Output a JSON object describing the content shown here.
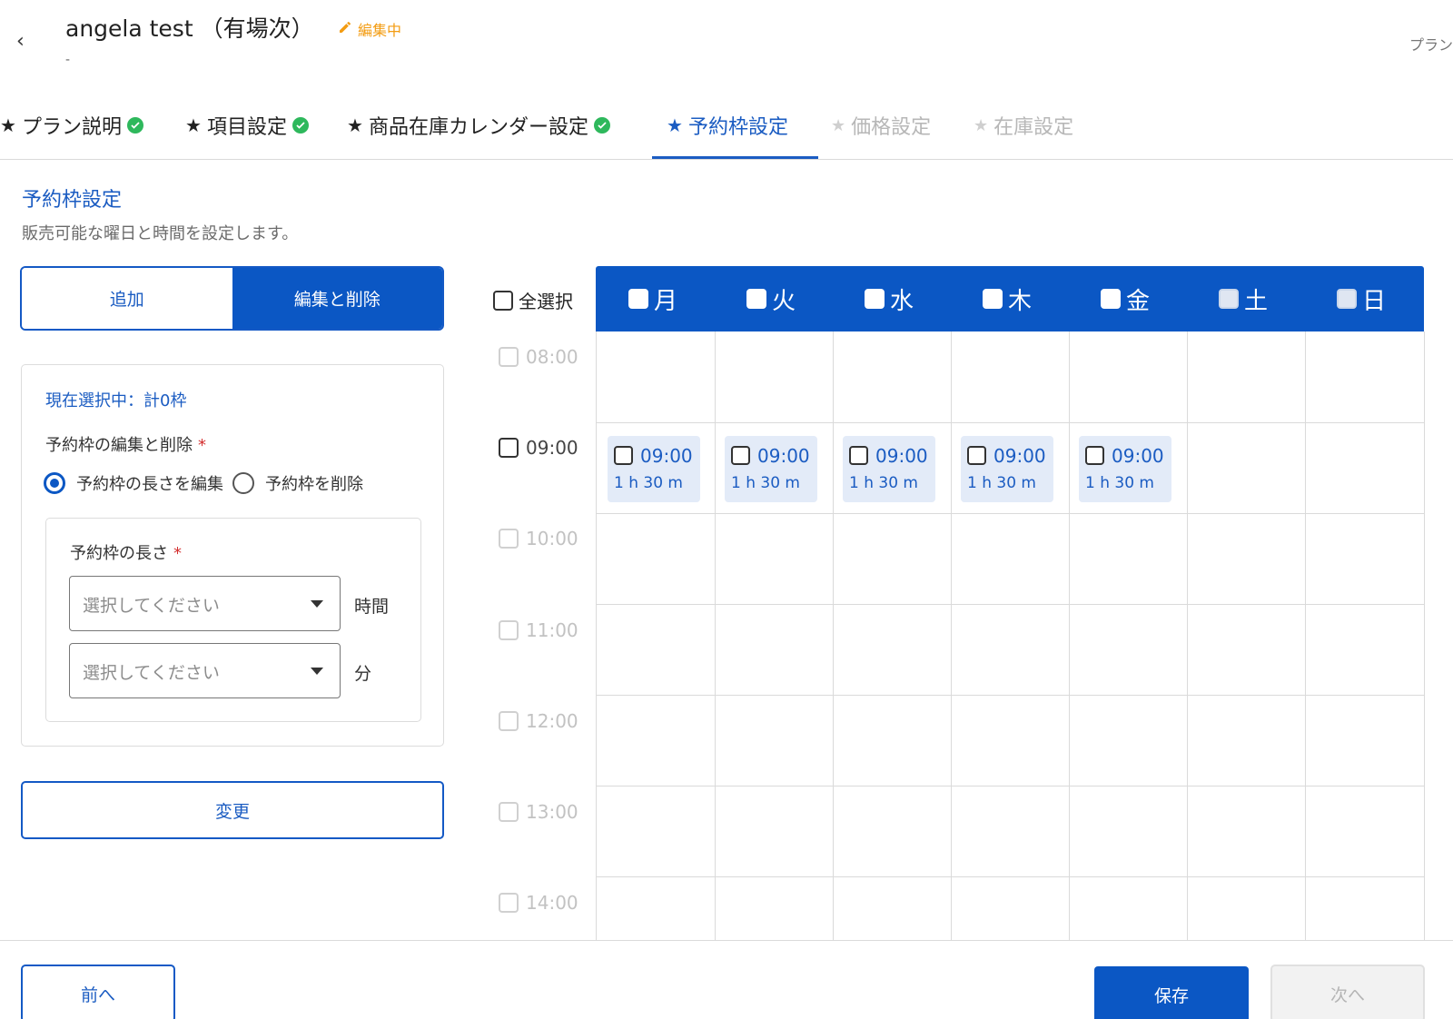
{
  "header": {
    "back_icon": "chevron-left-icon",
    "title": "angela test （有場次）",
    "edit_status": "編集中",
    "subtitle": "-",
    "top_right": "プラン"
  },
  "tabs": [
    {
      "label": "プラン説明",
      "state": "done"
    },
    {
      "label": "項目設定",
      "state": "done"
    },
    {
      "label": "商品在庫カレンダー設定",
      "state": "done"
    },
    {
      "label": "予約枠設定",
      "state": "active"
    },
    {
      "label": "価格設定",
      "state": "disabled"
    },
    {
      "label": "在庫設定",
      "state": "disabled"
    }
  ],
  "section": {
    "title": "予約枠設定",
    "description": "販売可能な曜日と時間を設定します。"
  },
  "mode_toggle": {
    "add_label": "追加",
    "edit_delete_label": "編集と削除",
    "selected": "編集と削除"
  },
  "edit_panel": {
    "selection_count": "現在選択中：計0枠",
    "edit_delete_label": "予約枠の編集と削除",
    "required_mark": "*",
    "radio_edit_length": "予約枠の長さを編集",
    "radio_delete": "予約枠を削除",
    "radio_selected": "予約枠の長さを編集",
    "length_label": "予約枠の長さ",
    "hours_placeholder": "選択してください",
    "hours_unit": "時間",
    "minutes_placeholder": "選択してください",
    "minutes_unit": "分",
    "change_button": "変更"
  },
  "calendar": {
    "select_all": "全選択",
    "days": [
      "月",
      "火",
      "水",
      "木",
      "金",
      "土",
      "日"
    ],
    "times": [
      "08:00",
      "09:00",
      "10:00",
      "11:00",
      "12:00",
      "13:00",
      "14:00"
    ],
    "slots": [
      {
        "day": "月",
        "time": "09:00",
        "duration": "1 h 30 m"
      },
      {
        "day": "火",
        "time": "09:00",
        "duration": "1 h 30 m"
      },
      {
        "day": "水",
        "time": "09:00",
        "duration": "1 h 30 m"
      },
      {
        "day": "木",
        "time": "09:00",
        "duration": "1 h 30 m"
      },
      {
        "day": "金",
        "time": "09:00",
        "duration": "1 h 30 m"
      }
    ]
  },
  "footer": {
    "prev_label": "前へ",
    "save_label": "保存",
    "next_label": "次へ"
  },
  "colors": {
    "primary": "#0b57c4",
    "success": "#2eb85c",
    "warning": "#f39c12",
    "required": "#d32f2f"
  }
}
